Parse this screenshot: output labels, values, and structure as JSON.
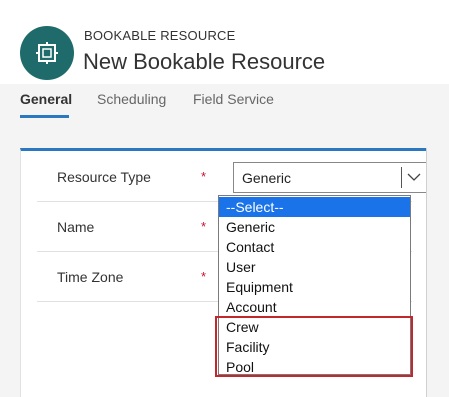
{
  "header": {
    "entity_label": "BOOKABLE RESOURCE",
    "record_title": "New Bookable Resource",
    "icon": "bookable-resource-icon",
    "icon_color": "#1f6b6b"
  },
  "tabs": [
    {
      "label": "General",
      "active": true
    },
    {
      "label": "Scheduling",
      "active": false
    },
    {
      "label": "Field Service",
      "active": false
    }
  ],
  "form": {
    "fields": [
      {
        "label": "Resource Type",
        "required": "*",
        "value": "Generic"
      },
      {
        "label": "Name",
        "required": "*",
        "value": ""
      },
      {
        "label": "Time Zone",
        "required": "*",
        "value": ""
      }
    ]
  },
  "dropdown": {
    "options": [
      "--Select--",
      "Generic",
      "Contact",
      "User",
      "Equipment",
      "Account",
      "Crew",
      "Facility",
      "Pool"
    ],
    "highlighted_index": 0
  },
  "colors": {
    "accent": "#2a78c0",
    "selected_option": "#1a73e8",
    "required": "#c8102e",
    "annotation_box": "#c1272d"
  }
}
